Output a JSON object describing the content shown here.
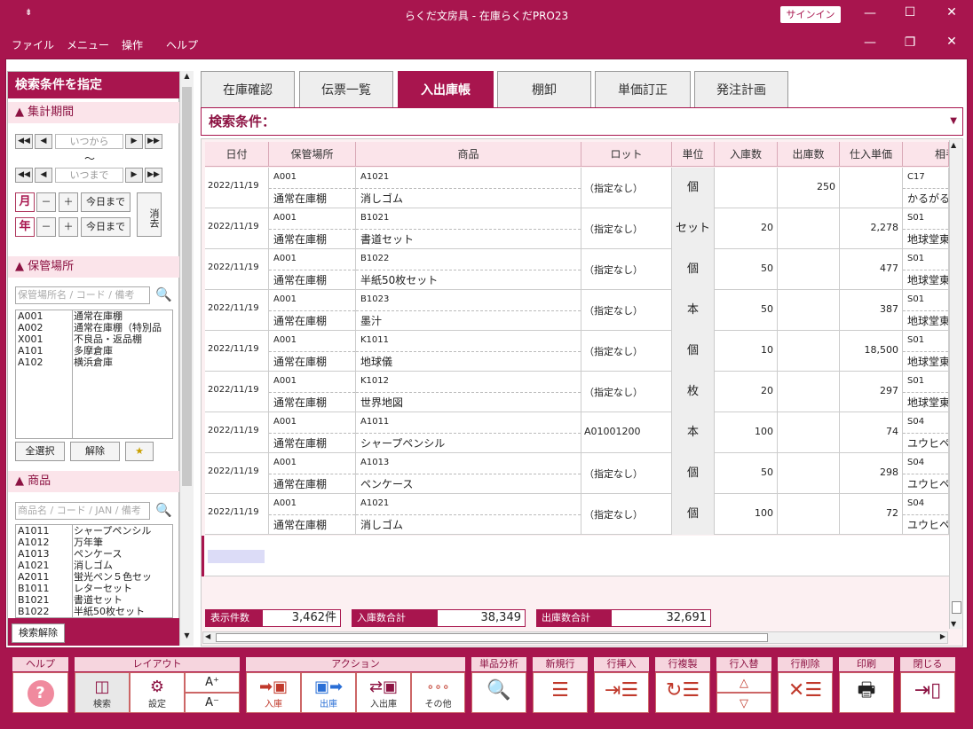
{
  "app": {
    "title": "らくだ文房具 - 在庫らくだPRO23",
    "signin": "サインイン"
  },
  "menu": [
    "ファイル",
    "メニュー",
    "操作",
    "ヘルプ"
  ],
  "left": {
    "header": "検索条件を指定",
    "period": {
      "label": "集計期間",
      "from": "いつから",
      "tilde": "～",
      "to": "いつまで",
      "month": "月",
      "year": "年",
      "minus": "－",
      "plus": "＋",
      "today": "今日まで",
      "clear": "消去"
    },
    "location": {
      "label": "保管場所",
      "placeholder": "保管場所名 / コード / 備考",
      "items": [
        [
          "A001",
          "通常在庫棚"
        ],
        [
          "A002",
          "通常在庫棚（特別品"
        ],
        [
          "X001",
          "不良品・返品棚"
        ],
        [
          "A101",
          "多摩倉庫"
        ],
        [
          "A102",
          "横浜倉庫"
        ]
      ],
      "select_all": "全選択",
      "release": "解除"
    },
    "product": {
      "label": "商品",
      "placeholder": "商品名 / コード / JAN / 備考",
      "items": [
        [
          "A1011",
          "シャープペンシル"
        ],
        [
          "A1012",
          "万年筆"
        ],
        [
          "A1013",
          "ペンケース"
        ],
        [
          "A1021",
          "消しゴム"
        ],
        [
          "A2011",
          "蛍光ペン５色セッ"
        ],
        [
          "B1011",
          "レターセット"
        ],
        [
          "B1021",
          "書道セット"
        ],
        [
          "B1022",
          "半紙50枚セット"
        ]
      ]
    },
    "search_release": "検索解除"
  },
  "tabs": [
    "在庫確認",
    "伝票一覧",
    "入出庫帳",
    "棚卸",
    "単価訂正",
    "発注計画"
  ],
  "active_tab": "入出庫帳",
  "search_label": "検索条件：",
  "columns": [
    "日付",
    "保管場所",
    "商品",
    "ロット",
    "単位",
    "入庫数",
    "出庫数",
    "仕入単価",
    "相手"
  ],
  "rows": [
    {
      "date": "2022/11/19",
      "loc_code": "A001",
      "loc_name": "通常在庫棚",
      "prod_code": "A1021",
      "prod_name": "消しゴム",
      "lot": "（指定なし）",
      "unit": "個",
      "in": "",
      "out": "250",
      "price": "",
      "partner_code": "C17",
      "partner_name": "かるがる"
    },
    {
      "date": "2022/11/19",
      "loc_code": "A001",
      "loc_name": "通常在庫棚",
      "prod_code": "B1021",
      "prod_name": "書道セット",
      "lot": "（指定なし）",
      "unit": "セット",
      "in": "20",
      "out": "",
      "price": "2,278",
      "partner_code": "S01",
      "partner_name": "地球堂東"
    },
    {
      "date": "2022/11/19",
      "loc_code": "A001",
      "loc_name": "通常在庫棚",
      "prod_code": "B1022",
      "prod_name": "半紙50枚セット",
      "lot": "（指定なし）",
      "unit": "個",
      "in": "50",
      "out": "",
      "price": "477",
      "partner_code": "S01",
      "partner_name": "地球堂東"
    },
    {
      "date": "2022/11/19",
      "loc_code": "A001",
      "loc_name": "通常在庫棚",
      "prod_code": "B1023",
      "prod_name": "墨汁",
      "lot": "（指定なし）",
      "unit": "本",
      "in": "50",
      "out": "",
      "price": "387",
      "partner_code": "S01",
      "partner_name": "地球堂東"
    },
    {
      "date": "2022/11/19",
      "loc_code": "A001",
      "loc_name": "通常在庫棚",
      "prod_code": "K1011",
      "prod_name": "地球儀",
      "lot": "（指定なし）",
      "unit": "個",
      "in": "10",
      "out": "",
      "price": "18,500",
      "partner_code": "S01",
      "partner_name": "地球堂東"
    },
    {
      "date": "2022/11/19",
      "loc_code": "A001",
      "loc_name": "通常在庫棚",
      "prod_code": "K1012",
      "prod_name": "世界地図",
      "lot": "（指定なし）",
      "unit": "枚",
      "in": "20",
      "out": "",
      "price": "297",
      "partner_code": "S01",
      "partner_name": "地球堂東"
    },
    {
      "date": "2022/11/19",
      "loc_code": "A001",
      "loc_name": "通常在庫棚",
      "prod_code": "A1011",
      "prod_name": "シャープペンシル",
      "lot": "A01001200",
      "unit": "本",
      "in": "100",
      "out": "",
      "price": "74",
      "partner_code": "S04",
      "partner_name": "ユウヒペ"
    },
    {
      "date": "2022/11/19",
      "loc_code": "A001",
      "loc_name": "通常在庫棚",
      "prod_code": "A1013",
      "prod_name": "ペンケース",
      "lot": "（指定なし）",
      "unit": "個",
      "in": "50",
      "out": "",
      "price": "298",
      "partner_code": "S04",
      "partner_name": "ユウヒペ"
    },
    {
      "date": "2022/11/19",
      "loc_code": "A001",
      "loc_name": "通常在庫棚",
      "prod_code": "A1021",
      "prod_name": "消しゴム",
      "lot": "（指定なし）",
      "unit": "個",
      "in": "100",
      "out": "",
      "price": "72",
      "partner_code": "S04",
      "partner_name": "ユウヒペ"
    }
  ],
  "totals": {
    "count_label": "表示件数",
    "count": "3,462件",
    "in_label": "入庫数合計",
    "in": "38,349",
    "out_label": "出庫数合計",
    "out": "32,691"
  },
  "toolbar": {
    "groups": [
      "ヘルプ",
      "レイアウト",
      "アクション",
      "単品分析",
      "新規行",
      "行挿入",
      "行複製",
      "行入替",
      "行削除",
      "印刷",
      "閉じる"
    ],
    "search": "検索",
    "settings": "設定",
    "in": "入庫",
    "out": "出庫",
    "inout": "入出庫",
    "other": "その他"
  }
}
